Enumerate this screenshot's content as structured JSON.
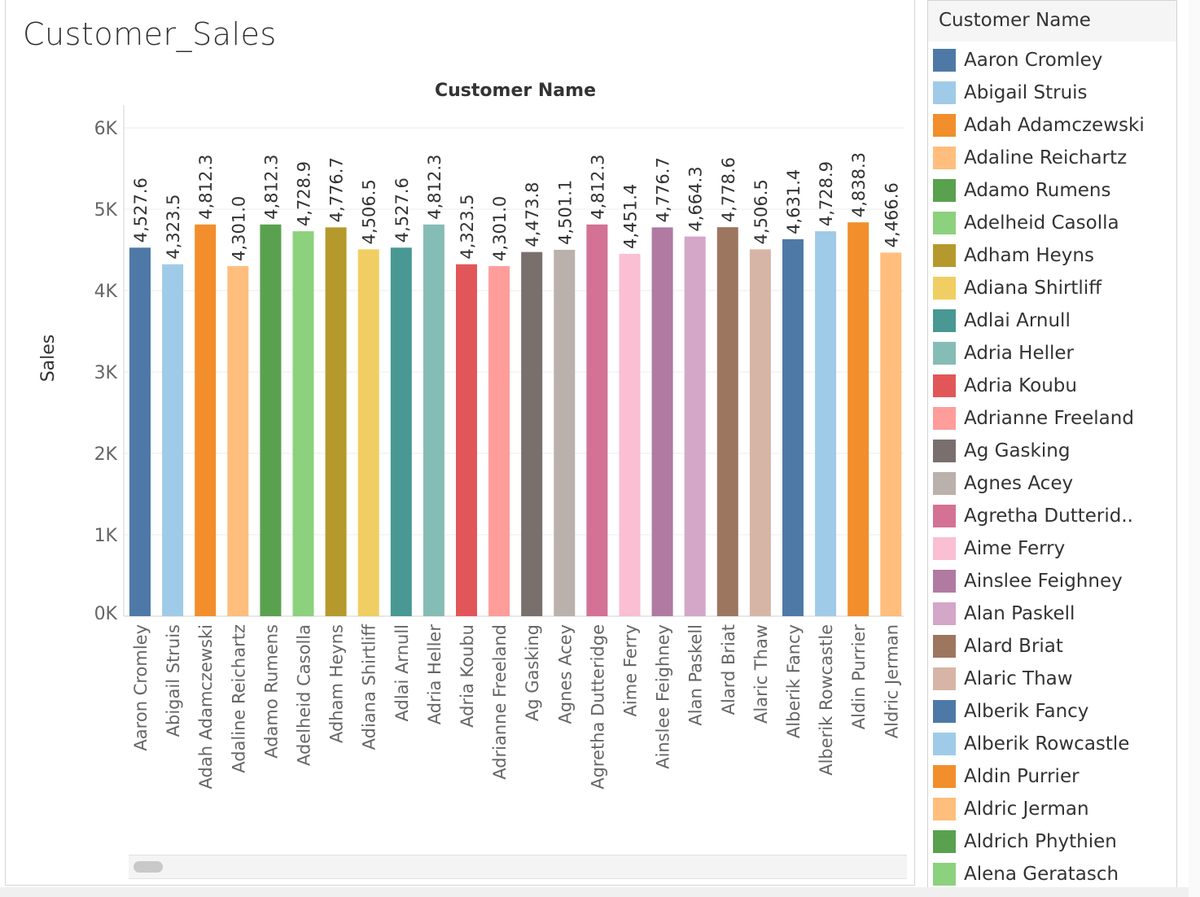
{
  "sheet": {
    "title": "Customer_Sales"
  },
  "legend": {
    "title": "Customer Name",
    "items": [
      {
        "label": "Aaron Cromley",
        "color": "#4e79a7"
      },
      {
        "label": "Abigail Struis",
        "color": "#a0cbe8"
      },
      {
        "label": "Adah Adamczewski",
        "color": "#f28e2b"
      },
      {
        "label": "Adaline Reichartz",
        "color": "#ffbe7d"
      },
      {
        "label": "Adamo Rumens",
        "color": "#59a14f"
      },
      {
        "label": "Adelheid Casolla",
        "color": "#8cd17d"
      },
      {
        "label": "Adham Heyns",
        "color": "#b6992d"
      },
      {
        "label": "Adiana Shirtliff",
        "color": "#f1ce63"
      },
      {
        "label": "Adlai Arnull",
        "color": "#499894"
      },
      {
        "label": "Adria Heller",
        "color": "#86bcb6"
      },
      {
        "label": "Adria Koubu",
        "color": "#e15759"
      },
      {
        "label": "Adrianne Freeland",
        "color": "#ff9d9a"
      },
      {
        "label": "Ag Gasking",
        "color": "#79706e"
      },
      {
        "label": "Agnes Acey",
        "color": "#bab0ac"
      },
      {
        "label": "Agretha Dutterid..",
        "color": "#d37295"
      },
      {
        "label": "Aime Ferry",
        "color": "#fabfd2"
      },
      {
        "label": "Ainslee Feighney",
        "color": "#b07aa1"
      },
      {
        "label": "Alan Paskell",
        "color": "#d4a6c8"
      },
      {
        "label": "Alard Briat",
        "color": "#9d7660"
      },
      {
        "label": "Alaric Thaw",
        "color": "#d7b5a6"
      },
      {
        "label": "Alberik Fancy",
        "color": "#4e79a7"
      },
      {
        "label": "Alberik Rowcastle",
        "color": "#a0cbe8"
      },
      {
        "label": "Aldin Purrier",
        "color": "#f28e2b"
      },
      {
        "label": "Aldric Jerman",
        "color": "#ffbe7d"
      },
      {
        "label": "Aldrich Phythien",
        "color": "#59a14f"
      },
      {
        "label": "Alena Geratasch",
        "color": "#8cd17d"
      }
    ]
  },
  "chart_data": {
    "type": "bar",
    "title": "Customer Name",
    "xlabel": "",
    "ylabel": "Sales",
    "ylim": [
      0,
      6000
    ],
    "yticks": [
      0,
      1000,
      2000,
      3000,
      4000,
      5000,
      6000
    ],
    "ytick_labels": [
      "0K",
      "1K",
      "2K",
      "3K",
      "4K",
      "5K",
      "6K"
    ],
    "grid": true,
    "legend_position": "right",
    "categories": [
      "Aaron Cromley",
      "Abigail Struis",
      "Adah Adamczewski",
      "Adaline Reichartz",
      "Adamo Rumens",
      "Adelheid Casolla",
      "Adham Heyns",
      "Adiana Shirtliff",
      "Adlai Arnull",
      "Adria Heller",
      "Adria Koubu",
      "Adrianne Freeland",
      "Ag Gasking",
      "Agnes Acey",
      "Agretha Dutteridge",
      "Aime Ferry",
      "Ainslee Feighney",
      "Alan Paskell",
      "Alard Briat",
      "Alaric Thaw",
      "Alberik Fancy",
      "Alberik Rowcastle",
      "Aldin Purrier",
      "Aldric Jerman"
    ],
    "values": [
      4527.6,
      4323.5,
      4812.3,
      4301.0,
      4812.3,
      4728.9,
      4776.7,
      4506.5,
      4527.6,
      4812.3,
      4323.5,
      4301.0,
      4473.8,
      4501.1,
      4812.3,
      4451.4,
      4776.7,
      4664.3,
      4778.6,
      4506.5,
      4631.4,
      4728.9,
      4838.3,
      4466.6
    ],
    "value_labels": [
      "4,527.6",
      "4,323.5",
      "4,812.3",
      "4,301.0",
      "4,812.3",
      "4,728.9",
      "4,776.7",
      "4,506.5",
      "4,527.6",
      "4,812.3",
      "4,323.5",
      "4,301.0",
      "4,473.8",
      "4,501.1",
      "4,812.3",
      "4,451.4",
      "4,776.7",
      "4,664.3",
      "4,778.6",
      "4,506.5",
      "4,631.4",
      "4,728.9",
      "4,838.3",
      "4,466.6"
    ],
    "colors": [
      "#4e79a7",
      "#a0cbe8",
      "#f28e2b",
      "#ffbe7d",
      "#59a14f",
      "#8cd17d",
      "#b6992d",
      "#f1ce63",
      "#499894",
      "#86bcb6",
      "#e15759",
      "#ff9d9a",
      "#79706e",
      "#bab0ac",
      "#d37295",
      "#fabfd2",
      "#b07aa1",
      "#d4a6c8",
      "#9d7660",
      "#d7b5a6",
      "#4e79a7",
      "#a0cbe8",
      "#f28e2b",
      "#ffbe7d"
    ]
  }
}
